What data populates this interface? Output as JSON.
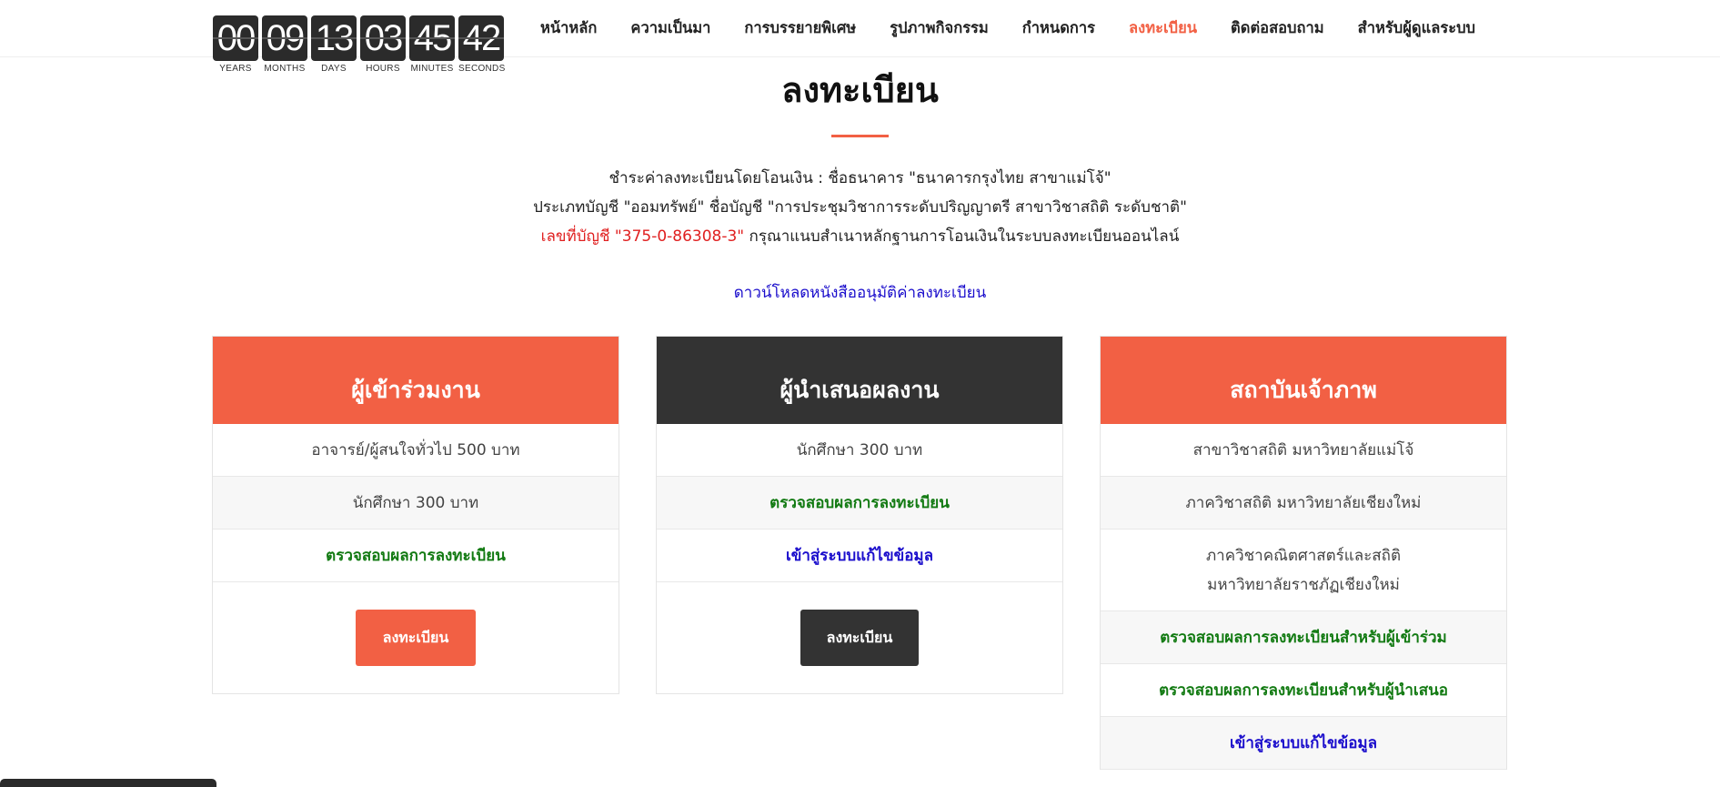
{
  "countdown": [
    {
      "value": "00",
      "label": "YEARS"
    },
    {
      "value": "09",
      "label": "MONTHS"
    },
    {
      "value": "13",
      "label": "DAYS"
    },
    {
      "value": "03",
      "label": "HOURS"
    },
    {
      "value": "45",
      "label": "MINUTES"
    },
    {
      "value": "42",
      "label": "SECONDS"
    }
  ],
  "nav": {
    "items": [
      {
        "label": "หน้าหลัก"
      },
      {
        "label": "ความเป็นมา"
      },
      {
        "label": "การบรรยายพิเศษ"
      },
      {
        "label": "รูปภาพกิจกรรม"
      },
      {
        "label": "กำหนดการ"
      },
      {
        "label": "ลงทะเบียน",
        "active": true
      },
      {
        "label": "ติดต่อสอบถาม"
      },
      {
        "label": "สำหรับผู้ดูแลระบบ"
      }
    ]
  },
  "page": {
    "title": "ลงทะเบียน",
    "info_line1": "ชำระค่าลงทะเบียนโดยโอนเงิน : ชื่อธนาคาร \"ธนาคารกรุงไทย สาขาแม่โจ้\"",
    "info_line2": "ประเภทบัญชี \"ออมทรัพย์\" ชื่อบัญชี \"การประชุมวิชาการระดับปริญญาตรี สาขาวิชาสถิติ ระดับชาติ\"",
    "info_line3_account": "เลขที่บัญชี \"375-0-86308-3\"",
    "info_line3_rest": " กรุณาแนบสำเนาหลักฐานการโอนเงินในระบบลงทะเบียนออนไลน์",
    "download_link": "ดาวน์โหลดหนังสืออนุมัติค่าลงทะเบียน"
  },
  "cards": {
    "participant": {
      "title": "ผู้เข้าร่วมงาน",
      "fee_general": "อาจารย์/ผู้สนใจทั่วไป 500 บาท",
      "fee_student": "นักศึกษา 300 บาท",
      "check_link": "ตรวจสอบผลการลงทะเบียน",
      "button": "ลงทะเบียน"
    },
    "presenter": {
      "title": "ผู้นำเสนอผลงาน",
      "fee_student": "นักศึกษา 300 บาท",
      "check_link": "ตรวจสอบผลการลงทะเบียน",
      "edit_link": "เข้าสู่ระบบแก้ไขข้อมูล",
      "button": "ลงทะเบียน"
    },
    "host": {
      "title": "สถาบันเจ้าภาพ",
      "inst1": "สาขาวิชาสถิติ มหาวิทยาลัยแม่โจ้",
      "inst2": "ภาควิชาสถิติ มหาวิทยาลัยเชียงใหม่",
      "inst3_line1": "ภาควิชาคณิตศาสตร์และสถิติ",
      "inst3_line2": "มหาวิทยาลัยราชภัฏเชียงใหม่",
      "check_participant": "ตรวจสอบผลการลงทะเบียนสำหรับผู้เข้าร่วม",
      "check_presenter": "ตรวจสอบผลการลงทะเบียนสำหรับผู้นำเสนอ",
      "edit_link": "เข้าสู่ระบบแก้ไขข้อมูล"
    }
  },
  "colors": {
    "accent": "#f26044",
    "dark": "#333333",
    "link_blue": "#1a0dcc",
    "link_green": "#127a12",
    "account_red": "#e02020"
  }
}
